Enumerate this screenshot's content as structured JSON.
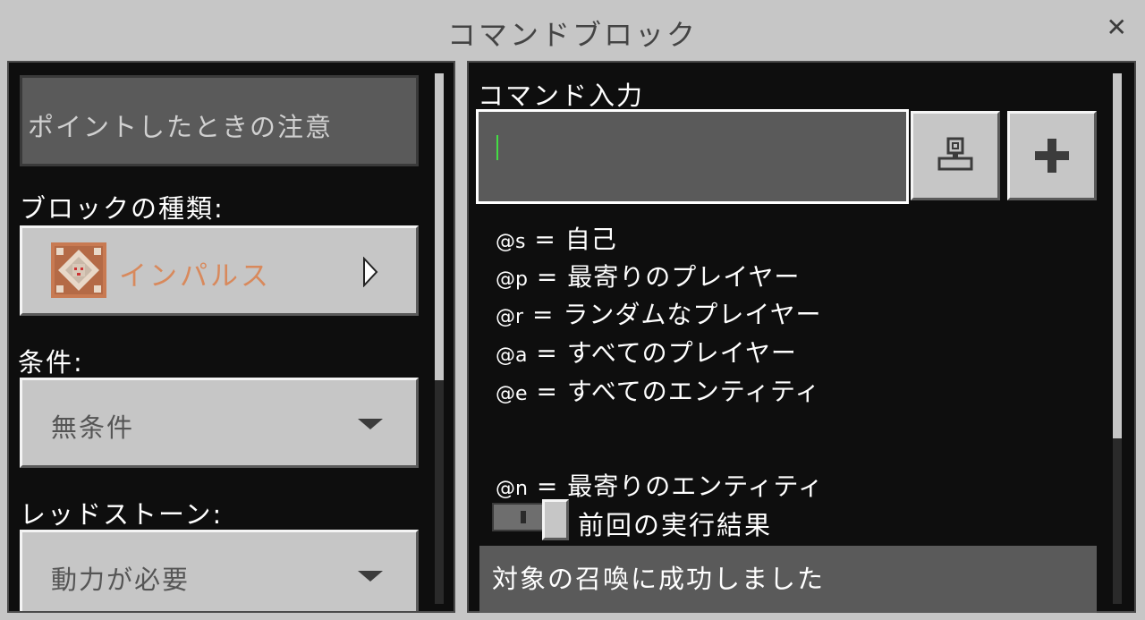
{
  "window": {
    "title": "コマンドブロック",
    "close_glyph": "✕"
  },
  "left": {
    "hover_note_value": "ポイントしたときの注意",
    "block_type_label": "ブロックの種類:",
    "block_type_value": "インパルス",
    "condition_label": "条件:",
    "condition_value": "無条件",
    "redstone_label": "レッドストーン:",
    "redstone_value": "動力が必要"
  },
  "right": {
    "command_input_label": "コマンド入力",
    "command_input_value": "",
    "selectors": [
      {
        "code": "@s",
        "text": "= 自己"
      },
      {
        "code": "@p",
        "text": "= 最寄りのプレイヤー"
      },
      {
        "code": "@r",
        "text": "= ランダムなプレイヤー"
      },
      {
        "code": "@a",
        "text": "= すべてのプレイヤー"
      },
      {
        "code": "@e",
        "text": "= すべてのエンティティ"
      },
      {
        "code": "@n",
        "text": "= 最寄りのエンティティ"
      }
    ],
    "previous_output_label": "前回の実行結果",
    "previous_output_toggle": "off",
    "previous_output_value": "対象の召喚に成功しました"
  },
  "colors": {
    "impulse_orange": "#d8895c",
    "cursor_green": "#44dd44",
    "background": "#c6c6c6",
    "panel": "#0e0e0e"
  },
  "icons": {
    "command_block": "command-block-icon",
    "block_picker": "block-picker-icon",
    "plus": "plus-icon",
    "arrow": "arrow-right-icon",
    "dropdown": "dropdown-arrow-icon"
  }
}
